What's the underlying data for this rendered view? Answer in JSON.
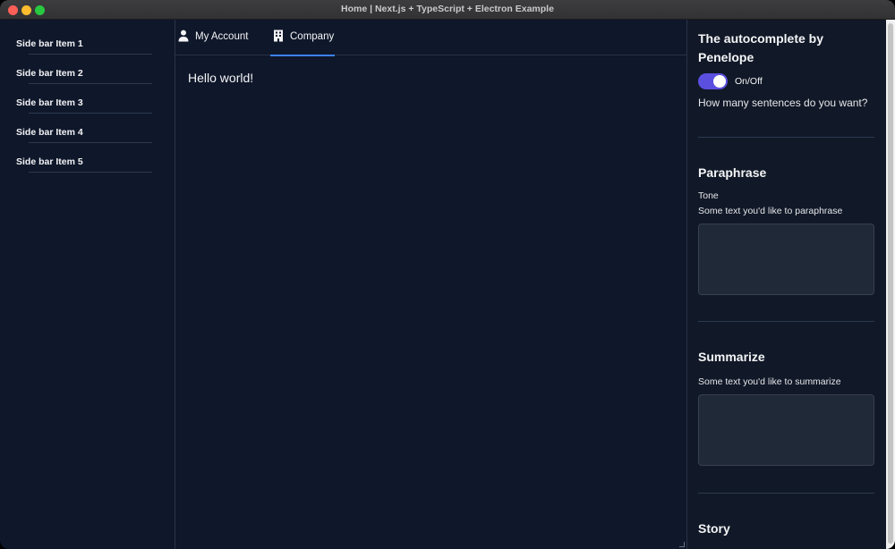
{
  "window": {
    "title": "Home | Next.js + TypeScript + Electron Example"
  },
  "sidebar": {
    "items": [
      {
        "label": "Side bar Item 1"
      },
      {
        "label": "Side bar Item 2"
      },
      {
        "label": "Side bar Item 3"
      },
      {
        "label": "Side bar Item 4"
      },
      {
        "label": "Side bar Item 5"
      }
    ]
  },
  "tabs": [
    {
      "label": "My Account",
      "icon": "user-icon",
      "active": false
    },
    {
      "label": "Company",
      "icon": "building-icon",
      "active": true
    }
  ],
  "main": {
    "content": "Hello world!"
  },
  "right_panel": {
    "autocomplete": {
      "title_line1": "The autocomplete by",
      "title_line2": "Penelope",
      "toggle_label": "On/Off",
      "toggle_on": true,
      "question": "How many sentences do you want?"
    },
    "paraphrase": {
      "title": "Paraphrase",
      "tone_label": "Tone",
      "field_label": "Some text you'd like to paraphrase",
      "value": ""
    },
    "summarize": {
      "title": "Summarize",
      "field_label": "Some text you'd like to summarize",
      "value": ""
    },
    "story": {
      "title": "Story"
    }
  },
  "colors": {
    "background": "#0f172a",
    "accent": "#3b82f6",
    "toggle": "#5b4fe0"
  }
}
